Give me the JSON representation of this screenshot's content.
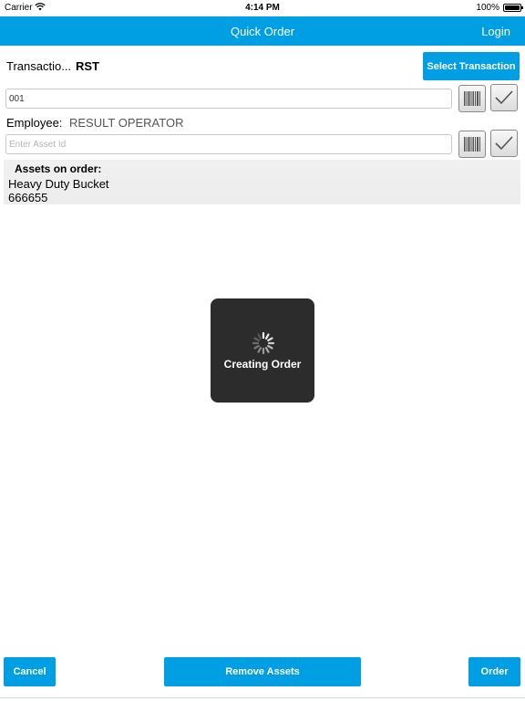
{
  "status_bar": {
    "carrier": "Carrier",
    "time": "4:14 PM",
    "battery": "100%"
  },
  "nav": {
    "title": "Quick Order",
    "login": "Login"
  },
  "transaction": {
    "label": "Transactio...",
    "value": "RST",
    "select_button": "Select Transaction",
    "field_value": "001"
  },
  "employee": {
    "label": "Employee:",
    "value": "RESULT OPERATOR"
  },
  "asset_input": {
    "placeholder": "Enter Asset Id",
    "value": ""
  },
  "assets": {
    "header": "Assets on order:",
    "items": [
      {
        "name": "Heavy Duty Bucket",
        "number": "666655"
      }
    ]
  },
  "hud": {
    "message": "Creating Order"
  },
  "footer": {
    "cancel": "Cancel",
    "remove": "Remove Assets",
    "order": "Order"
  },
  "colors": {
    "accent": "#009fe3",
    "hud_background": "#2c2c2c",
    "panel_background": "#efefef"
  },
  "icons": {
    "wifi": "wifi-icon",
    "battery": "battery-icon",
    "barcode": "barcode-icon",
    "check": "checkmark-icon",
    "spinner": "loading-spinner-icon"
  }
}
